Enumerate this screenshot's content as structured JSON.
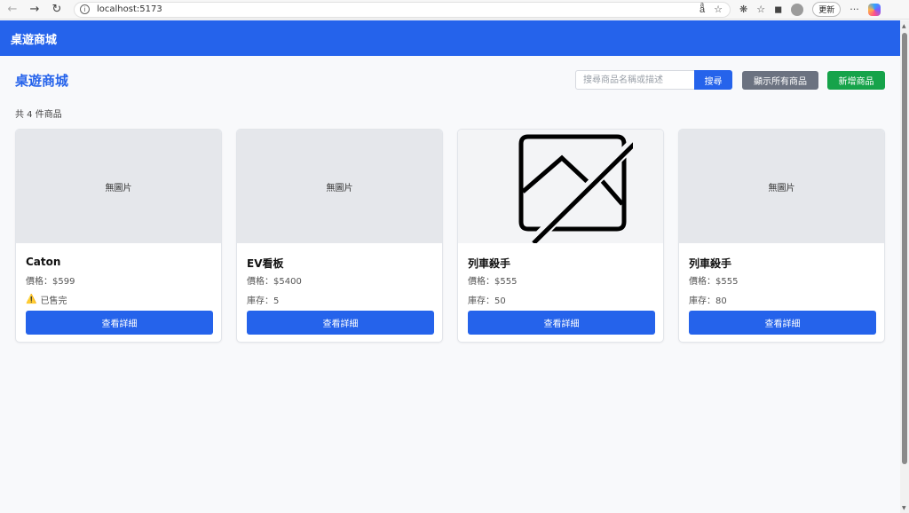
{
  "browser": {
    "url": "localhost:5173",
    "update_label": "更新",
    "more_label": "···"
  },
  "header": {
    "brand": "桌遊商城"
  },
  "main": {
    "title": "桌遊商城",
    "search": {
      "placeholder": "搜尋商品名稱或描述",
      "button_label": "搜尋"
    },
    "show_all_label": "顯示所有商品",
    "add_label": "新增商品",
    "count_text": "共 4 件商品"
  },
  "products": [
    {
      "image_text": "無圖片",
      "name": "Caton",
      "price": "價格：$599",
      "stock": "已售完",
      "sold_out": true,
      "detail_label": "查看詳細"
    },
    {
      "image_text": "無圖片",
      "name": "EV看板",
      "price": "價格：$5400",
      "stock": "庫存：5",
      "sold_out": false,
      "detail_label": "查看詳細"
    },
    {
      "image_text": "",
      "name": "列車殺手",
      "price": "價格：$555",
      "stock": "庫存：50",
      "sold_out": false,
      "detail_label": "查看詳細",
      "image_icon": "broken-image-icon"
    },
    {
      "image_text": "無圖片",
      "name": "列車殺手",
      "price": "價格：$555",
      "stock": "庫存：80",
      "sold_out": false,
      "detail_label": "查看詳細"
    }
  ],
  "colors": {
    "primary": "#2563eb",
    "secondary": "#6b7280",
    "success": "#16a34a",
    "warning": "#f59e0b"
  }
}
